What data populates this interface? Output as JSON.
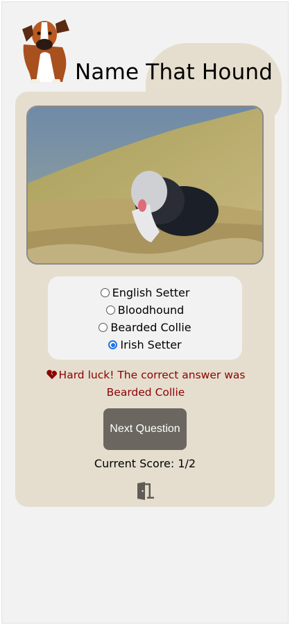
{
  "app": {
    "title": "Name That Hound"
  },
  "question": {
    "image_alt": "Bearded Collie running through grass",
    "options": [
      {
        "label": "English Setter",
        "selected": false
      },
      {
        "label": "Bloodhound",
        "selected": false
      },
      {
        "label": "Bearded Collie",
        "selected": false
      },
      {
        "label": "Irish Setter",
        "selected": true
      }
    ]
  },
  "feedback": {
    "icon": "broken-heart-icon",
    "text": "Hard luck! The correct answer was Bearded Collie"
  },
  "next_button": {
    "label": "Next Question"
  },
  "score": {
    "text": "Current Score: 1/2"
  },
  "exit": {
    "icon": "door-exit-icon"
  },
  "colors": {
    "page_bg": "#f2f2f2",
    "card_bg": "#e5dece",
    "button_bg": "#6b6760",
    "feedback": "#8b0000",
    "radio_checked": "#1a73e8"
  }
}
